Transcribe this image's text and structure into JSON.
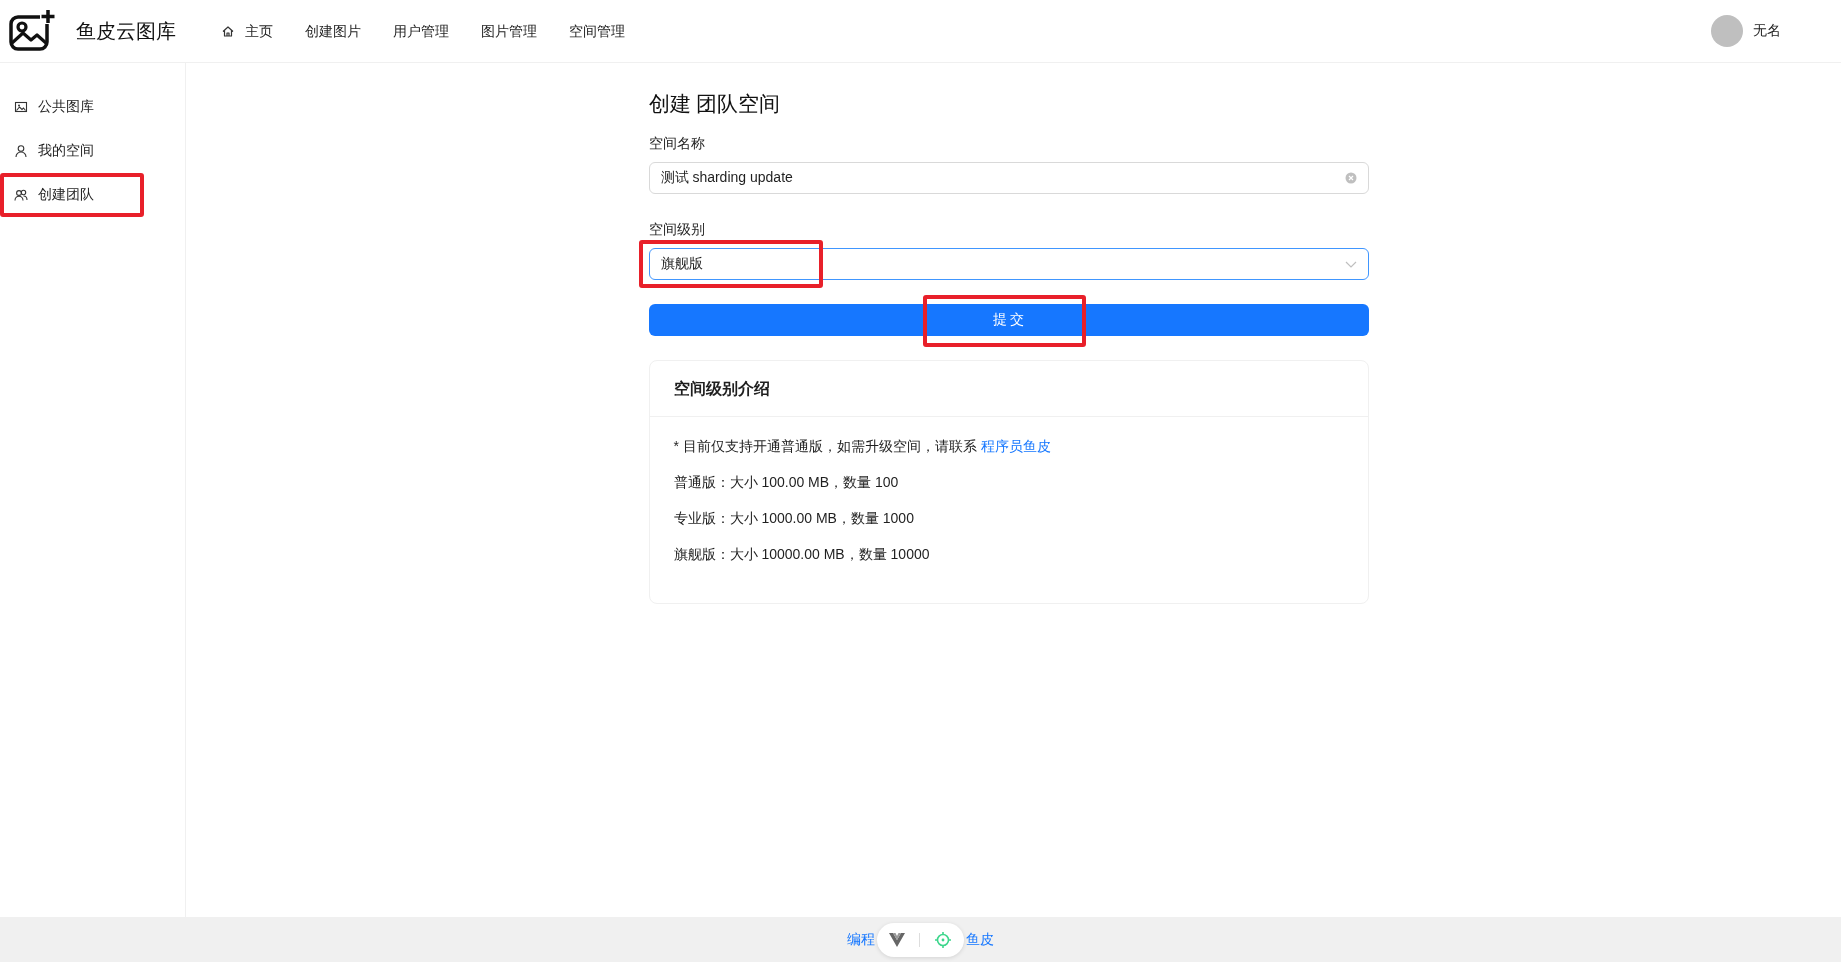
{
  "header": {
    "logo_text": "鱼皮云图库",
    "nav": [
      {
        "label": "主页"
      },
      {
        "label": "创建图片"
      },
      {
        "label": "用户管理"
      },
      {
        "label": "图片管理"
      },
      {
        "label": "空间管理"
      }
    ],
    "user": {
      "name": "无名"
    }
  },
  "sidebar": {
    "items": [
      {
        "label": "公共图库"
      },
      {
        "label": "我的空间"
      },
      {
        "label": "创建团队",
        "highlighted": true
      }
    ]
  },
  "form": {
    "title": "创建 团队空间",
    "fields": [
      {
        "kind": "input",
        "label": "空间名称",
        "value": "测试 sharding update",
        "focused": false
      },
      {
        "kind": "select",
        "label": "空间级别",
        "value": "旗舰版",
        "focused": true,
        "highlighted": true
      }
    ],
    "submit": {
      "label": "提 交",
      "highlighted": true
    }
  },
  "info_card": {
    "title": "空间级别介绍",
    "note": "* 目前仅支持开通普通版，如需升级空间，请联系 ",
    "link": "程序员鱼皮",
    "levels": [
      "普通版：大小 100.00 MB，数量 100",
      "专业版：大小 1000.00 MB，数量 1000",
      "旗舰版：大小 10000.00 MB，数量 10000"
    ]
  },
  "footer": {
    "text_left": "编程",
    "text_right": "鱼皮"
  }
}
